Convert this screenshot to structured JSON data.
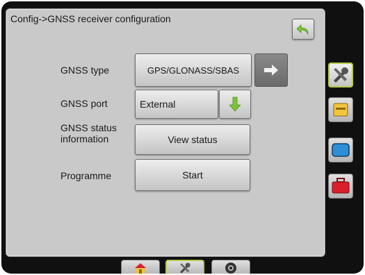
{
  "header": {
    "title": "Config->GNSS receiver configuration"
  },
  "rows": {
    "gnss_type": {
      "label": "GNSS type",
      "value": "GPS/GLONASS/SBAS"
    },
    "gnss_port": {
      "label": "GNSS port",
      "value": "External"
    },
    "gnss_status": {
      "label": "GNSS status\ninformation",
      "button": "View status"
    },
    "programme": {
      "label": "Programme",
      "button": "Start"
    }
  },
  "icons": {
    "back": "undo-arrow-icon",
    "next": "arrow-right-icon",
    "dropdown": "arrow-down-icon",
    "side": [
      "tools-icon",
      "implement-icon",
      "screen-icon",
      "toolbox-icon"
    ],
    "bottom": [
      "home-icon",
      "tools-icon",
      "camera-icon"
    ]
  },
  "colors": {
    "accent_green": "#7cc43a",
    "active_border": "#b9c94c",
    "toolbox_red": "#d8202a",
    "implement_yellow": "#f2c53d",
    "screen_blue": "#2e8fd6"
  }
}
